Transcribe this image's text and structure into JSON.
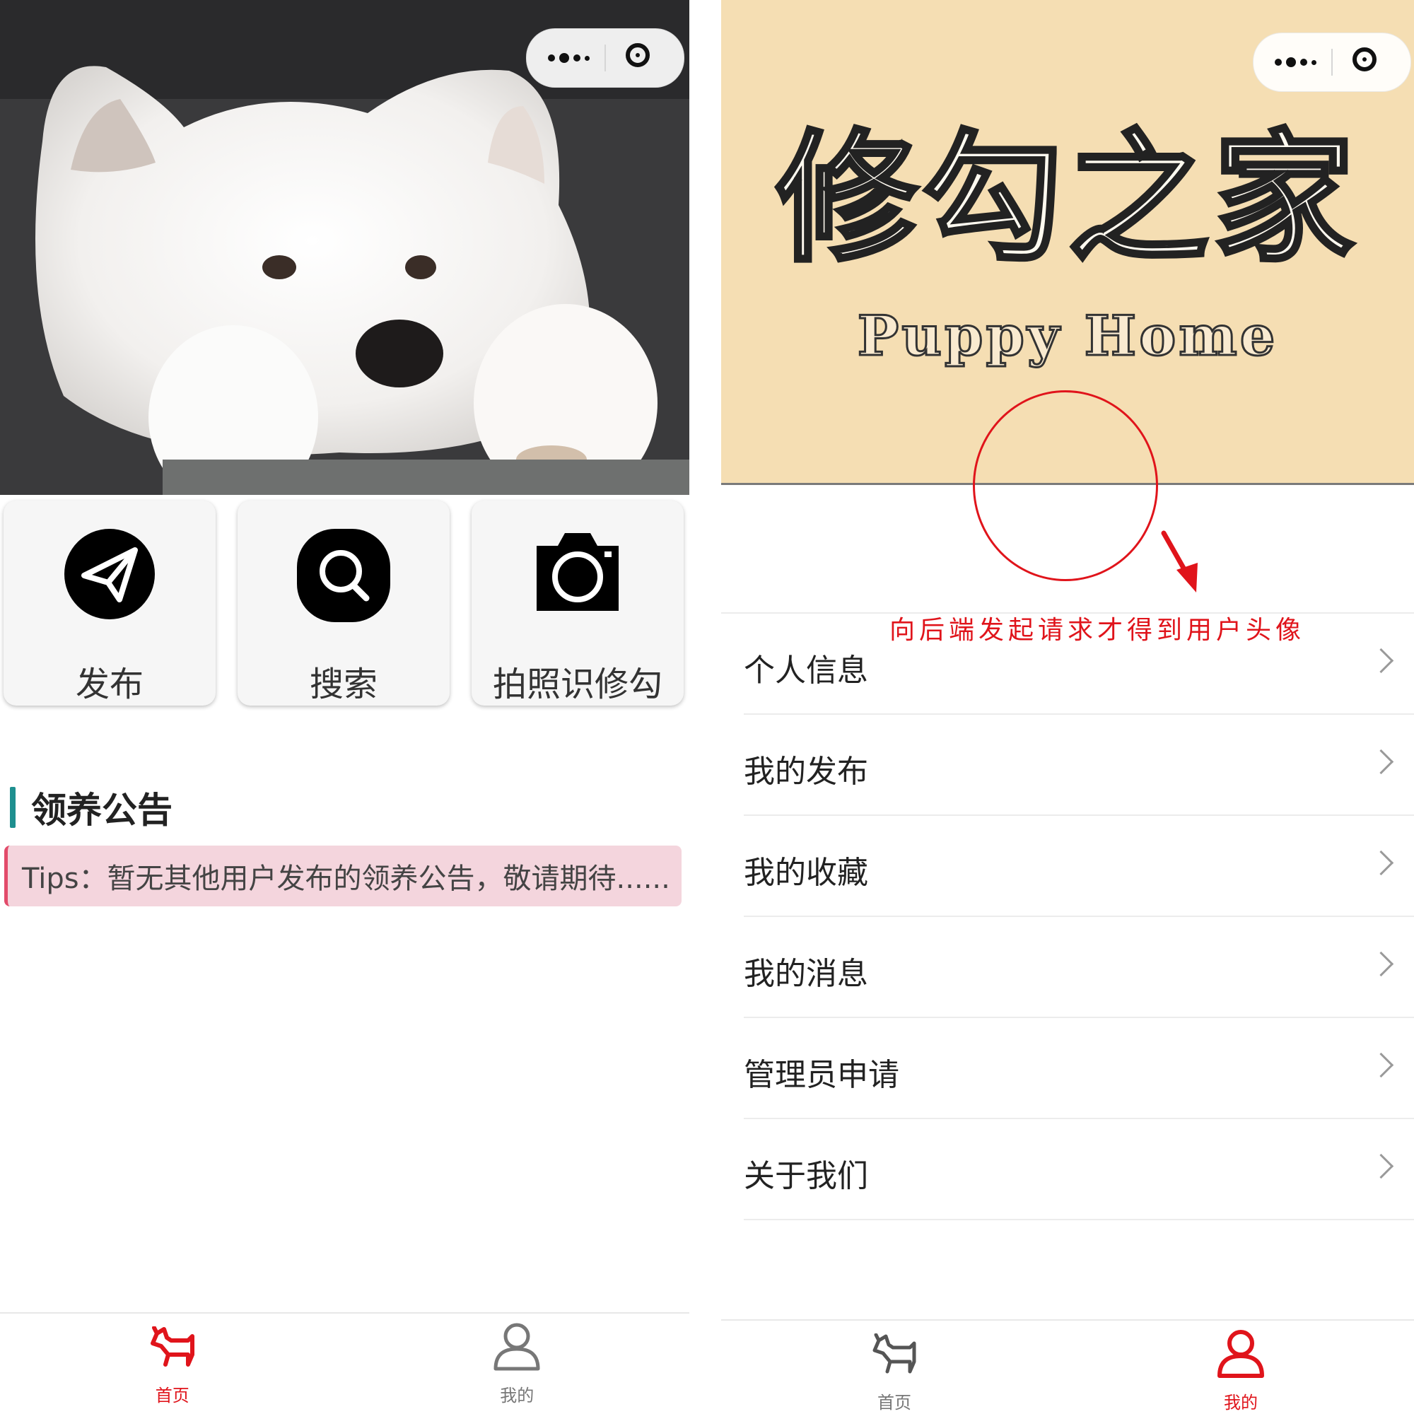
{
  "left_screen": {
    "actions": [
      {
        "label": "发布",
        "icon": "paper-plane-icon"
      },
      {
        "label": "搜索",
        "icon": "search-icon"
      },
      {
        "label": "拍照识修勾",
        "icon": "camera-icon"
      }
    ],
    "notice": {
      "title": "领养公告",
      "tips": "Tips：暂无其他用户发布的领养公告，敬请期待......"
    },
    "tabbar": [
      {
        "label": "首页",
        "icon": "dog-icon",
        "active": true
      },
      {
        "label": "我的",
        "icon": "user-icon",
        "active": false
      }
    ]
  },
  "right_screen": {
    "brand_title": "修勾之家",
    "brand_subtitle": "Puppy Home",
    "annotation": "向后端发起请求才得到用户头像",
    "menu": [
      {
        "label": "个人信息"
      },
      {
        "label": "我的发布"
      },
      {
        "label": "我的收藏"
      },
      {
        "label": "我的消息"
      },
      {
        "label": "管理员申请"
      },
      {
        "label": "关于我们"
      }
    ],
    "tabbar": [
      {
        "label": "首页",
        "icon": "dog-icon",
        "active": false
      },
      {
        "label": "我的",
        "icon": "user-icon",
        "active": true
      }
    ]
  },
  "colors": {
    "accent_red": "#e0141b",
    "header_tan": "#f5deb3",
    "notice_bar": "#1e8f8f",
    "tips_bg": "#f4d5dd",
    "tab_inactive": "#777777"
  }
}
